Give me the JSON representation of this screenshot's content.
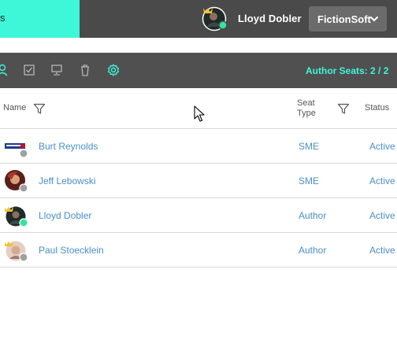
{
  "header": {
    "active_tab_label": "s",
    "user_name": "Lloyd Dobler",
    "org_label": "FictionSoft",
    "brand_accent": "#3ef6d8",
    "topbar_color": "#4a4a4a",
    "user_status_color": "#2ee6a0"
  },
  "toolbar": {
    "icons": [
      "user-icon",
      "checkbox-icon",
      "monitor-icon",
      "trash-icon",
      "gear-icon"
    ],
    "seats_label": "Author Seats:",
    "seats_value": "2 / 2"
  },
  "table": {
    "columns": {
      "name": "Name",
      "seat_type_line1": "Seat",
      "seat_type_line2": "Type",
      "status": "Status"
    },
    "rows": [
      {
        "name": "Burt Reynolds",
        "seat_type": "SME",
        "status": "Active",
        "crown": false,
        "online": false,
        "avatar": "banner-avatar"
      },
      {
        "name": "Jeff Lebowski",
        "seat_type": "SME",
        "status": "Active",
        "crown": false,
        "online": false,
        "avatar": "photo-avatar"
      },
      {
        "name": "Lloyd Dobler",
        "seat_type": "Author",
        "status": "Active",
        "crown": true,
        "online": true,
        "avatar": "photo-avatar"
      },
      {
        "name": "Paul Stoecklein",
        "seat_type": "Author",
        "status": "Active",
        "crown": true,
        "online": false,
        "avatar": "photo-avatar"
      }
    ],
    "link_color": "#4a8fc8",
    "offline_color": "#a0a0a0",
    "online_color": "#2ee6a0"
  }
}
